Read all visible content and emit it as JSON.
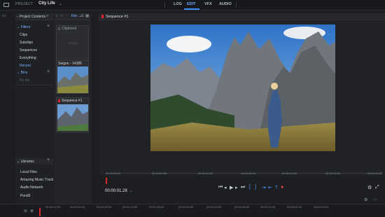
{
  "project": {
    "label": "PROJECT",
    "name": "City Life"
  },
  "tabs": [
    {
      "label": "LOG"
    },
    {
      "label": "EDIT"
    },
    {
      "label": "VFX"
    },
    {
      "label": "AUDIO"
    }
  ],
  "left_panel": {
    "title": "Project Contents",
    "filters_label": "Filters",
    "items": [
      "Clips",
      "Subclips",
      "Sequences",
      "Everything",
      "Recent"
    ],
    "bins_label": "Bins",
    "bins_items": [
      "No bin"
    ],
    "libraries_label": "Libraries",
    "libraries": [
      "Local Files",
      "Amazing Music Track",
      "Audio Network",
      "Pond5"
    ]
  },
  "bin_panel": {
    "clips": [
      {
        "label": "Clipboard",
        "empty_text": "Empty"
      },
      {
        "label": "Seigon - 14385"
      },
      {
        "label": "Sequence #1"
      }
    ]
  },
  "viewer": {
    "title": "Sequence #1",
    "ruler_labels": [
      "00:00:00.00",
      "00:00:02:58",
      "00:00:12:00",
      "00:00:24:00",
      "00:00:13:00",
      "00:00:12:00",
      "00:00:16:00"
    ],
    "timecode": "00:00:01.28"
  },
  "timeline": {
    "ticks": [
      "00:00:12:00",
      "00:00:24:00",
      "00:00:48:00",
      "00:01:12:00",
      "00:01:36:00",
      "00:02:00:00",
      "00:02:24:00",
      "00:02:48:00",
      "00:03:12:00",
      "00:03:36:00",
      "00:04:00:00"
    ]
  },
  "colors": {
    "accent": "#3d8bff",
    "record": "#e0262b"
  }
}
